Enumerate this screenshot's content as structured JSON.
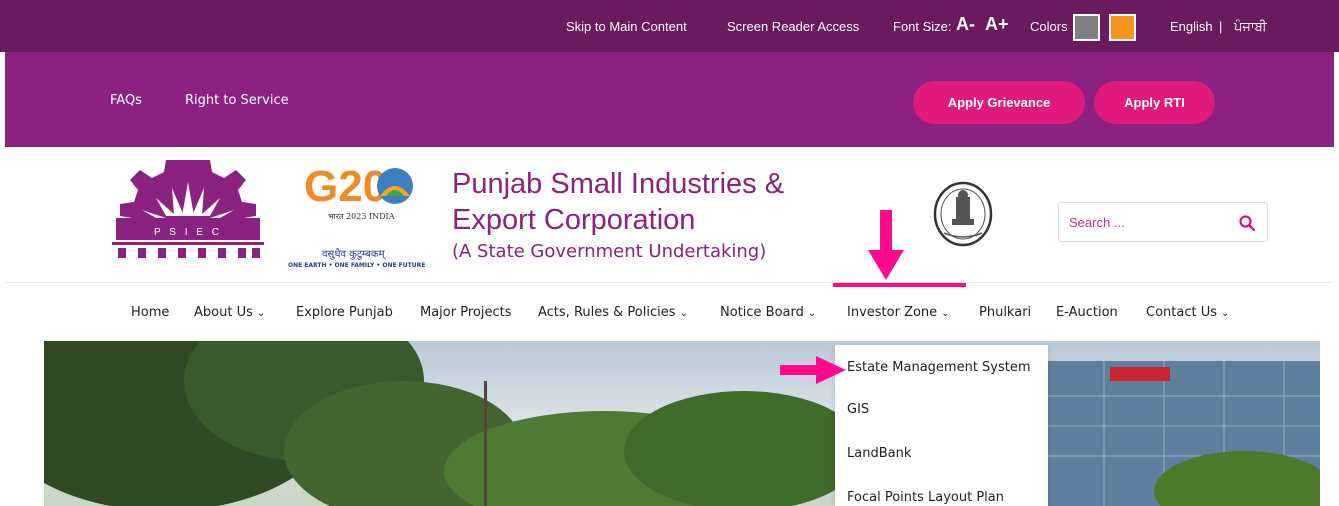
{
  "utility_bar": {
    "skip_link": "Skip to Main Content",
    "screen_reader": "Screen Reader Access",
    "font_size_label": "Font Size:",
    "font_decrease": "A-",
    "font_increase": "A+",
    "colors_label": "Colors",
    "color_swatches": [
      "#808080",
      "#f7931e"
    ],
    "lang_english": "English",
    "lang_separator": "|",
    "lang_punjabi": "ਪੰਜਾਬੀ"
  },
  "secondary_nav": {
    "links": [
      "FAQs",
      "Right to Service"
    ],
    "grievance_button": "Apply Grievance",
    "rti_button": "Apply RTI"
  },
  "header": {
    "logo_text": "P S I E C",
    "g20_text": "G20",
    "g20_tagline": "भारत 2023 INDIA",
    "g20_motto_hindi": "वसुधैव कुटुम्बकम्",
    "g20_motto_english": "ONE EARTH • ONE FAMILY • ONE FUTURE",
    "title_line1": "Punjab Small Industries &",
    "title_line2": "Export Corporation",
    "subtitle": "(A State Government Undertaking)",
    "search_placeholder": "Search ..."
  },
  "main_menu": {
    "items": [
      {
        "label": "Home",
        "has_dropdown": false
      },
      {
        "label": "About Us",
        "has_dropdown": true
      },
      {
        "label": "Explore Punjab",
        "has_dropdown": false
      },
      {
        "label": "Major Projects",
        "has_dropdown": false
      },
      {
        "label": "Acts, Rules & Policies",
        "has_dropdown": true
      },
      {
        "label": "Notice Board",
        "has_dropdown": true
      },
      {
        "label": "Investor Zone",
        "has_dropdown": true
      },
      {
        "label": "Phulkari",
        "has_dropdown": false
      },
      {
        "label": "E-Auction",
        "has_dropdown": false
      },
      {
        "label": "Contact Us",
        "has_dropdown": true
      }
    ],
    "caret": "⌄"
  },
  "investor_zone_dropdown": {
    "items": [
      "Estate Management System",
      "GIS",
      "LandBank",
      "Focal Points Layout Plan"
    ]
  },
  "colors": {
    "top_bar": "#6a1a5e",
    "nav_bar": "#8b2181",
    "pill": "#e0197d",
    "annotation_arrow": "#ff0a8c"
  }
}
